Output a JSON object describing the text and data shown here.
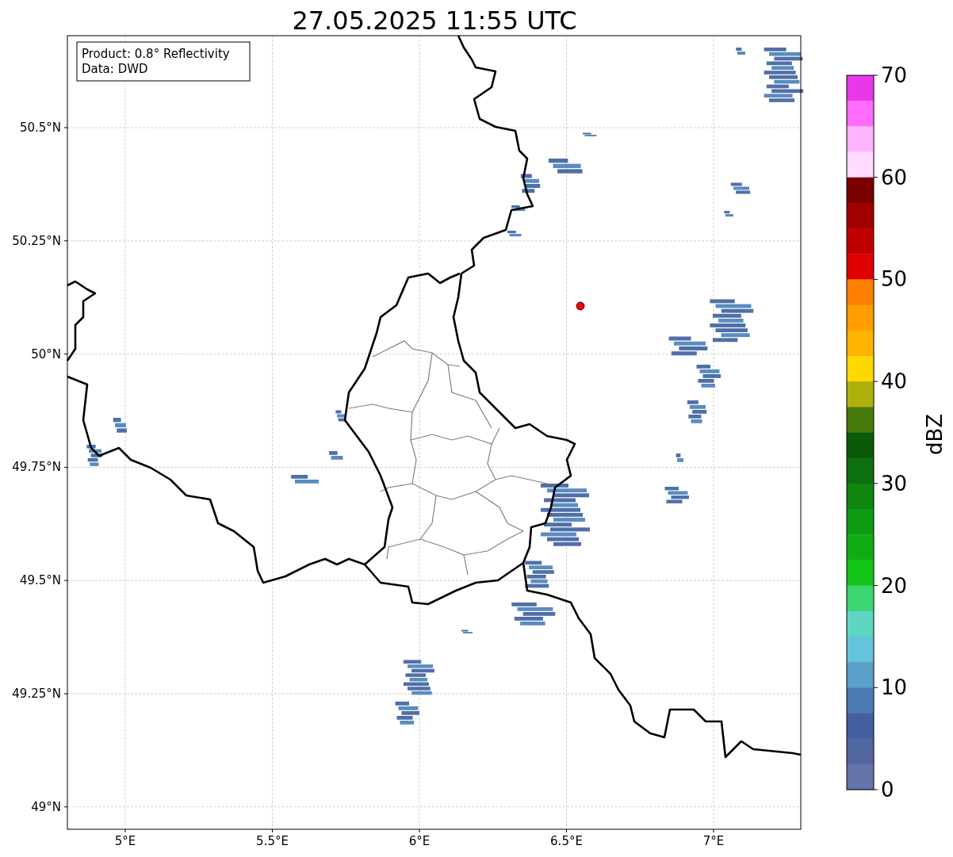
{
  "title": "27.05.2025 11:55 UTC",
  "map": {
    "legend": [
      "Product: 0.8° Reflectivity",
      "Data: DWD"
    ],
    "xticks": [
      "5°E",
      "5.5°E",
      "6°E",
      "6.5°E",
      "7°E"
    ],
    "yticks": [
      "50.5°N",
      "50.25°N",
      "50°N",
      "49.75°N",
      "49.5°N",
      "49.25°N",
      "49°N"
    ]
  },
  "colorbar": {
    "label": "dBZ",
    "ticks": [
      "70",
      "60",
      "50",
      "40",
      "30",
      "20",
      "10",
      "0"
    ],
    "bands": [
      {
        "color": "#e838e8"
      },
      {
        "color": "#ff6cff"
      },
      {
        "color": "#ffb4ff"
      },
      {
        "color": "#ffdcff"
      },
      {
        "color": "#7a0000"
      },
      {
        "color": "#a00000"
      },
      {
        "color": "#c00000"
      },
      {
        "color": "#e00000"
      },
      {
        "color": "#ff8000"
      },
      {
        "color": "#ff9c00"
      },
      {
        "color": "#ffb400"
      },
      {
        "color": "#ffd800"
      },
      {
        "color": "#b0b00a"
      },
      {
        "color": "#477a0a"
      },
      {
        "color": "#0a5a0a"
      },
      {
        "color": "#0c7010"
      },
      {
        "color": "#0e8610"
      },
      {
        "color": "#0e9a12"
      },
      {
        "color": "#10ac14"
      },
      {
        "color": "#12c418"
      },
      {
        "color": "#3dd672"
      },
      {
        "color": "#5fd6c2"
      },
      {
        "color": "#65c3dc"
      },
      {
        "color": "#5aa0c8"
      },
      {
        "color": "#4a7bb3"
      },
      {
        "color": "#445fa0"
      },
      {
        "color": "#5468a0"
      },
      {
        "color": "#6474a8"
      }
    ]
  }
}
